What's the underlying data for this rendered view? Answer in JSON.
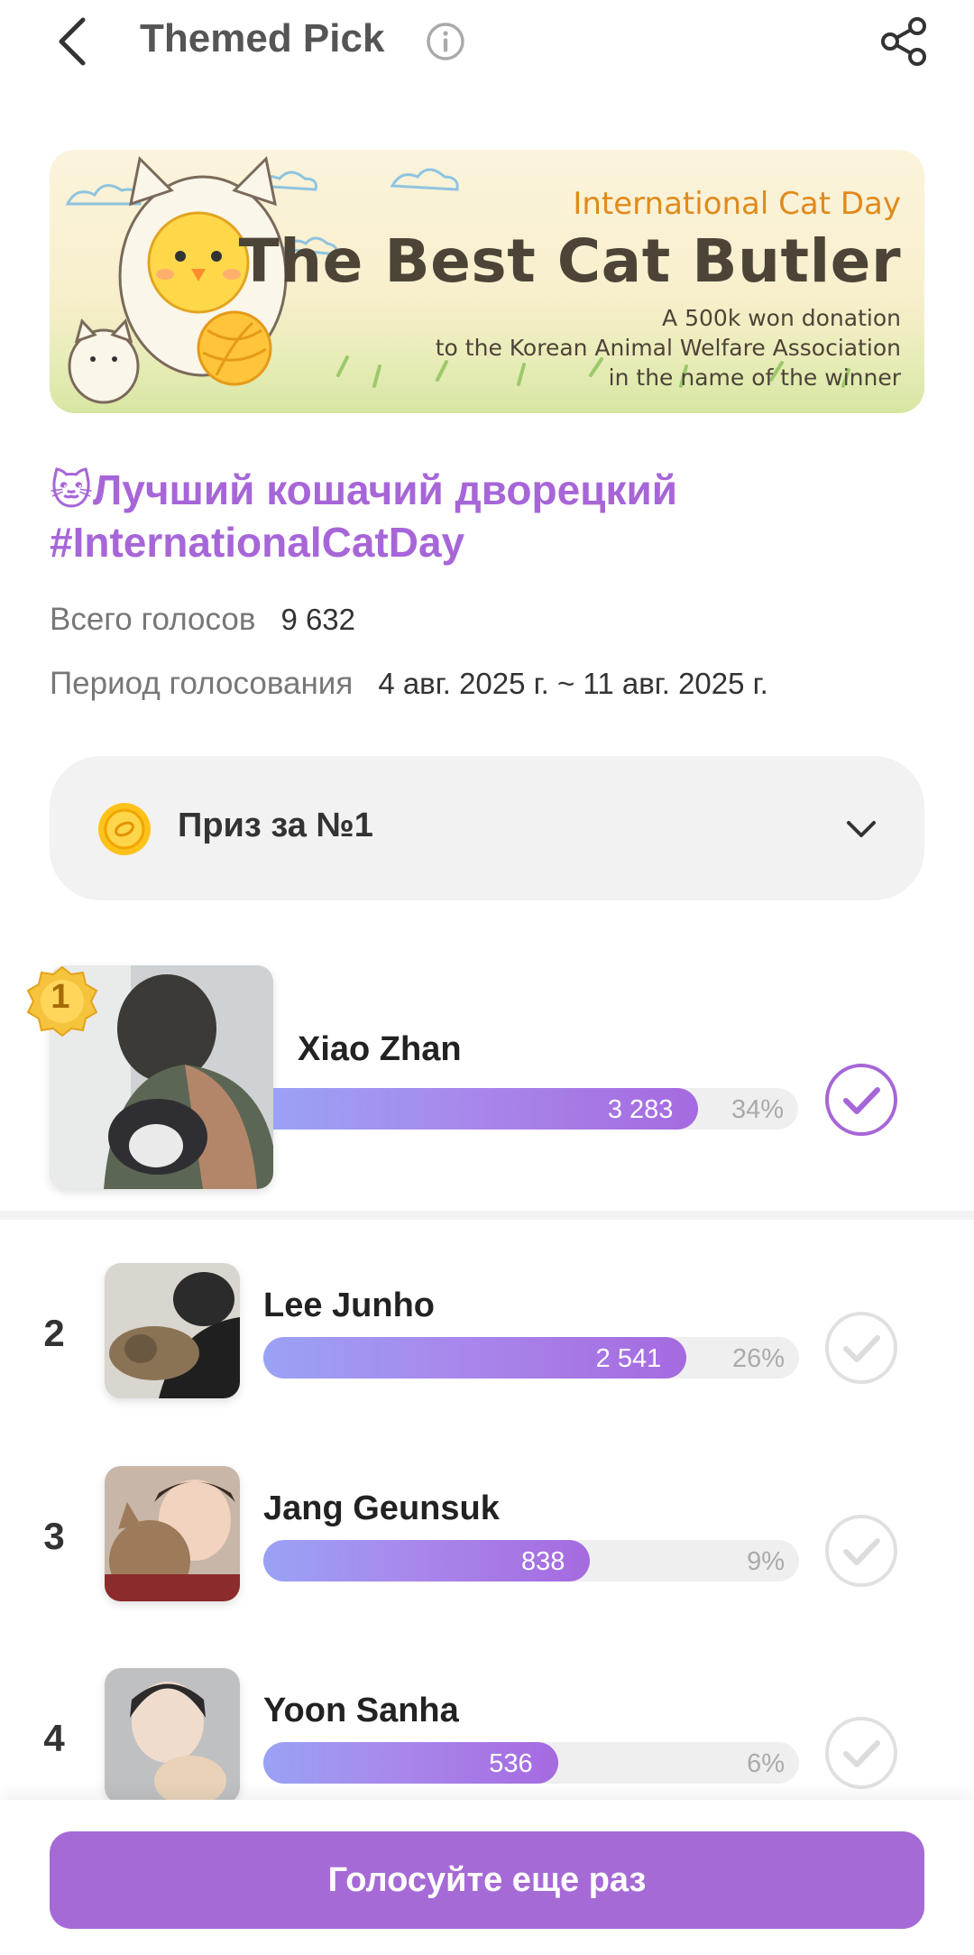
{
  "header": {
    "title": "Themed Pick",
    "back_icon": "chevron-left-icon",
    "info_icon": "info-icon",
    "share_icon": "share-icon"
  },
  "banner": {
    "subtitle": "International Cat Day",
    "title": "The Best Cat Butler",
    "desc_line1": "A 500k won donation",
    "desc_line2": "to the Korean Animal Welfare Association",
    "desc_line3": "in the name of the winner"
  },
  "poll": {
    "title_line1": "🐱Лучший кошачий дворецкий",
    "title_line2": "#InternationalCatDay",
    "total_label": "Всего голосов",
    "total_value": "9 632",
    "period_label": "Период голосования",
    "period_value": "4 авг. 2025 г. ~ 11 авг. 2025 г."
  },
  "prize": {
    "label": "Приз за №1",
    "icon": "coin-icon",
    "toggle_icon": "chevron-down-icon"
  },
  "candidates": [
    {
      "rank": "1",
      "name": "Xiao Zhan",
      "votes": "3 283",
      "percent": "34%",
      "fill": 0.81,
      "selected": true
    },
    {
      "rank": "2",
      "name": "Lee Junho",
      "votes": "2 541",
      "percent": "26%",
      "fill": 0.79,
      "selected": false
    },
    {
      "rank": "3",
      "name": "Jang Geunsuk",
      "votes": "838",
      "percent": "9%",
      "fill": 0.61,
      "selected": false
    },
    {
      "rank": "4",
      "name": "Yoon Sanha",
      "votes": "536",
      "percent": "6%",
      "fill": 0.55,
      "selected": false
    }
  ],
  "colors": {
    "accent": "#a766d8",
    "bar_start": "#9aa2f5",
    "bar_end": "#a56ae0",
    "cta": "#a66ad6"
  },
  "cta": {
    "label": "Голосуйте еще раз"
  }
}
